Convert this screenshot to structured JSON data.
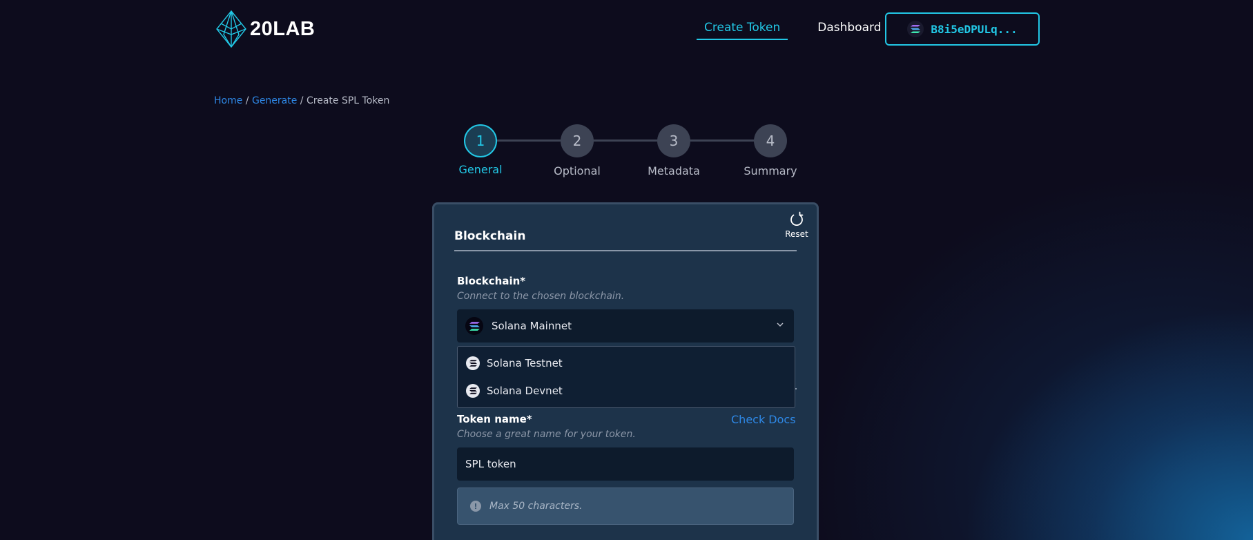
{
  "header": {
    "logo_text": "20LAB",
    "nav": [
      {
        "label": "Create Token",
        "active": true
      },
      {
        "label": "Dashboard",
        "active": false
      }
    ],
    "wallet_label": "B8i5eDPULq..."
  },
  "breadcrumb": {
    "home": "Home",
    "sep1": " / ",
    "generate": "Generate",
    "sep2": " / ",
    "current": "Create SPL Token"
  },
  "stepper": {
    "steps": [
      {
        "number": "1",
        "label": "General",
        "active": true
      },
      {
        "number": "2",
        "label": "Optional",
        "active": false
      },
      {
        "number": "3",
        "label": "Metadata",
        "active": false
      },
      {
        "number": "4",
        "label": "Summary",
        "active": false
      }
    ]
  },
  "card": {
    "reset_label": "Reset",
    "section_title": "Blockchain",
    "blockchain_field": {
      "label": "Blockchain*",
      "help": "Connect to the chosen blockchain.",
      "selected": "Solana Mainnet",
      "options": [
        "Solana Testnet",
        "Solana Devnet"
      ]
    },
    "token_name_field": {
      "label": "Token name*",
      "help": "Choose a great name for your token.",
      "docs_link": "Check Docs",
      "value": "SPL token",
      "info": "Max 50 characters."
    }
  },
  "colors": {
    "accent": "#22c8e6",
    "link": "#2e88e6",
    "background": "#0d0c1d",
    "card": "#1d334a"
  }
}
